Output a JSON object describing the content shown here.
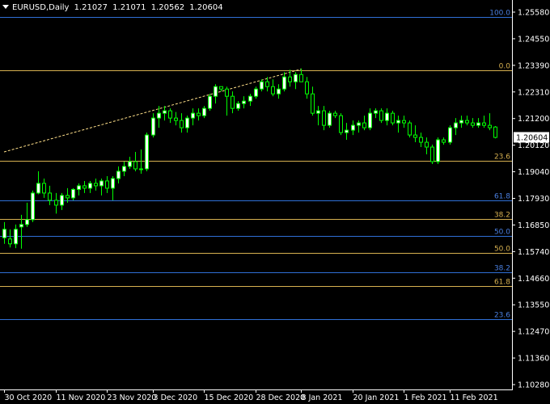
{
  "header": {
    "symbol": "EURUSD,Daily",
    "open": "1.21027",
    "high": "1.21071",
    "low": "1.20562",
    "close": "1.20604"
  },
  "price_axis": {
    "labels": [
      "1.25580",
      "1.24550",
      "1.23390",
      "1.22310",
      "1.21200",
      "1.20120",
      "1.19040",
      "1.17930",
      "1.16850",
      "1.15740",
      "1.14660",
      "1.13550",
      "1.12470",
      "1.11360",
      "1.10280"
    ],
    "current_price": "1.20604"
  },
  "time_axis": {
    "labels": [
      "30 Oct 2020",
      "11 Nov 2020",
      "23 Nov 2020",
      "3 Dec 2020",
      "15 Dec 2020",
      "28 Dec 2020",
      "8 Jan 2021",
      "20 Jan 2021",
      "1 Feb 2021",
      "11 Feb 2021"
    ]
  },
  "fibo_levels": [
    {
      "label": "100.0",
      "price": 1.2558,
      "color": "#2f6fd6",
      "label_color": "#4a7fe0"
    },
    {
      "label": "0.0",
      "price": 1.2339,
      "color": "#d6b050",
      "label_color": "#d6b050"
    },
    {
      "label": "23.6",
      "price": 1.1962,
      "color": "#d6b050",
      "label_color": "#d6b050"
    },
    {
      "label": "61.8",
      "price": 1.18,
      "color": "#2f6fd6",
      "label_color": "#4a7fe0"
    },
    {
      "label": "38.2",
      "price": 1.1722,
      "color": "#d6b050",
      "label_color": "#d6b050"
    },
    {
      "label": "50.0",
      "price": 1.1651,
      "color": "#2f6fd6",
      "label_color": "#4a7fe0"
    },
    {
      "label": "50.0",
      "price": 1.1581,
      "color": "#d6b050",
      "label_color": "#d6b050"
    },
    {
      "label": "38.2",
      "price": 1.1502,
      "color": "#2f6fd6",
      "label_color": "#4a7fe0"
    },
    {
      "label": "61.8",
      "price": 1.1445,
      "color": "#d6b050",
      "label_color": "#d6b050"
    },
    {
      "label": "23.6",
      "price": 1.1308,
      "color": "#2f6fd6",
      "label_color": "#4a7fe0"
    }
  ],
  "colors": {
    "background": "#000000",
    "bull": "#ffffff",
    "bear": "#000000",
    "wick": "#00ff00",
    "axis": "#ffffff",
    "trendline": "#ffe08a"
  },
  "chart_data": {
    "type": "candlestick",
    "symbol": "EURUSD",
    "timeframe": "Daily",
    "ylim": [
      1.1028,
      1.2588
    ],
    "trendline": {
      "from": {
        "date": "30 Oct 2020",
        "price": 1.2
      },
      "to": {
        "date": "31 Dec 2020",
        "price": 1.2342
      }
    },
    "candles": [
      {
        "o": 1.1645,
        "h": 1.171,
        "l": 1.162,
        "c": 1.168
      },
      {
        "o": 1.164,
        "h": 1.168,
        "l": 1.1605,
        "c": 1.162
      },
      {
        "o": 1.162,
        "h": 1.17,
        "l": 1.1602,
        "c": 1.168
      },
      {
        "o": 1.169,
        "h": 1.174,
        "l": 1.16,
        "c": 1.17
      },
      {
        "o": 1.17,
        "h": 1.179,
        "l": 1.169,
        "c": 1.172
      },
      {
        "o": 1.172,
        "h": 1.184,
        "l": 1.171,
        "c": 1.183
      },
      {
        "o": 1.183,
        "h": 1.192,
        "l": 1.1825,
        "c": 1.187
      },
      {
        "o": 1.187,
        "h": 1.189,
        "l": 1.181,
        "c": 1.183
      },
      {
        "o": 1.183,
        "h": 1.186,
        "l": 1.178,
        "c": 1.18
      },
      {
        "o": 1.18,
        "h": 1.183,
        "l": 1.1745,
        "c": 1.178
      },
      {
        "o": 1.178,
        "h": 1.183,
        "l": 1.176,
        "c": 1.182
      },
      {
        "o": 1.182,
        "h": 1.185,
        "l": 1.179,
        "c": 1.181
      },
      {
        "o": 1.181,
        "h": 1.185,
        "l": 1.18,
        "c": 1.1845
      },
      {
        "o": 1.1845,
        "h": 1.187,
        "l": 1.182,
        "c": 1.186
      },
      {
        "o": 1.186,
        "h": 1.188,
        "l": 1.183,
        "c": 1.185
      },
      {
        "o": 1.185,
        "h": 1.188,
        "l": 1.183,
        "c": 1.187
      },
      {
        "o": 1.187,
        "h": 1.189,
        "l": 1.184,
        "c": 1.186
      },
      {
        "o": 1.186,
        "h": 1.189,
        "l": 1.182,
        "c": 1.188
      },
      {
        "o": 1.188,
        "h": 1.19,
        "l": 1.183,
        "c": 1.185
      },
      {
        "o": 1.185,
        "h": 1.19,
        "l": 1.18,
        "c": 1.189
      },
      {
        "o": 1.189,
        "h": 1.194,
        "l": 1.187,
        "c": 1.192
      },
      {
        "o": 1.192,
        "h": 1.196,
        "l": 1.19,
        "c": 1.194
      },
      {
        "o": 1.194,
        "h": 1.198,
        "l": 1.193,
        "c": 1.196
      },
      {
        "o": 1.196,
        "h": 1.2,
        "l": 1.192,
        "c": 1.193
      },
      {
        "o": 1.193,
        "h": 1.201,
        "l": 1.191,
        "c": 1.193
      },
      {
        "o": 1.193,
        "h": 1.208,
        "l": 1.192,
        "c": 1.207
      },
      {
        "o": 1.207,
        "h": 1.216,
        "l": 1.206,
        "c": 1.214
      },
      {
        "o": 1.214,
        "h": 1.219,
        "l": 1.21,
        "c": 1.216
      },
      {
        "o": 1.216,
        "h": 1.219,
        "l": 1.213,
        "c": 1.217
      },
      {
        "o": 1.217,
        "h": 1.218,
        "l": 1.212,
        "c": 1.214
      },
      {
        "o": 1.214,
        "h": 1.2165,
        "l": 1.211,
        "c": 1.213
      },
      {
        "o": 1.213,
        "h": 1.216,
        "l": 1.208,
        "c": 1.21
      },
      {
        "o": 1.21,
        "h": 1.215,
        "l": 1.208,
        "c": 1.214
      },
      {
        "o": 1.214,
        "h": 1.218,
        "l": 1.211,
        "c": 1.216
      },
      {
        "o": 1.216,
        "h": 1.218,
        "l": 1.213,
        "c": 1.215
      },
      {
        "o": 1.215,
        "h": 1.219,
        "l": 1.214,
        "c": 1.218
      },
      {
        "o": 1.218,
        "h": 1.224,
        "l": 1.217,
        "c": 1.223
      },
      {
        "o": 1.223,
        "h": 1.228,
        "l": 1.22,
        "c": 1.227
      },
      {
        "o": 1.227,
        "h": 1.227,
        "l": 1.225,
        "c": 1.226
      },
      {
        "o": 1.226,
        "h": 1.227,
        "l": 1.215,
        "c": 1.223
      },
      {
        "o": 1.223,
        "h": 1.225,
        "l": 1.216,
        "c": 1.218
      },
      {
        "o": 1.218,
        "h": 1.221,
        "l": 1.217,
        "c": 1.22
      },
      {
        "o": 1.22,
        "h": 1.223,
        "l": 1.218,
        "c": 1.221
      },
      {
        "o": 1.221,
        "h": 1.224,
        "l": 1.219,
        "c": 1.223
      },
      {
        "o": 1.223,
        "h": 1.227,
        "l": 1.222,
        "c": 1.226
      },
      {
        "o": 1.226,
        "h": 1.23,
        "l": 1.225,
        "c": 1.229
      },
      {
        "o": 1.229,
        "h": 1.231,
        "l": 1.225,
        "c": 1.227
      },
      {
        "o": 1.227,
        "h": 1.23,
        "l": 1.223,
        "c": 1.224
      },
      {
        "o": 1.224,
        "h": 1.228,
        "l": 1.222,
        "c": 1.226
      },
      {
        "o": 1.226,
        "h": 1.233,
        "l": 1.225,
        "c": 1.231
      },
      {
        "o": 1.231,
        "h": 1.234,
        "l": 1.227,
        "c": 1.229
      },
      {
        "o": 1.229,
        "h": 1.233,
        "l": 1.226,
        "c": 1.232
      },
      {
        "o": 1.232,
        "h": 1.2345,
        "l": 1.229,
        "c": 1.229
      },
      {
        "o": 1.229,
        "h": 1.231,
        "l": 1.222,
        "c": 1.224
      },
      {
        "o": 1.224,
        "h": 1.227,
        "l": 1.215,
        "c": 1.216
      },
      {
        "o": 1.216,
        "h": 1.219,
        "l": 1.211,
        "c": 1.217
      },
      {
        "o": 1.217,
        "h": 1.219,
        "l": 1.209,
        "c": 1.211
      },
      {
        "o": 1.211,
        "h": 1.217,
        "l": 1.21,
        "c": 1.216
      },
      {
        "o": 1.216,
        "h": 1.217,
        "l": 1.214,
        "c": 1.215
      },
      {
        "o": 1.215,
        "h": 1.216,
        "l": 1.207,
        "c": 1.208
      },
      {
        "o": 1.208,
        "h": 1.212,
        "l": 1.205,
        "c": 1.209
      },
      {
        "o": 1.209,
        "h": 1.213,
        "l": 1.207,
        "c": 1.211
      },
      {
        "o": 1.211,
        "h": 1.213,
        "l": 1.208,
        "c": 1.212
      },
      {
        "o": 1.212,
        "h": 1.215,
        "l": 1.209,
        "c": 1.21
      },
      {
        "o": 1.21,
        "h": 1.218,
        "l": 1.209,
        "c": 1.216
      },
      {
        "o": 1.216,
        "h": 1.218,
        "l": 1.214,
        "c": 1.217
      },
      {
        "o": 1.217,
        "h": 1.218,
        "l": 1.212,
        "c": 1.213
      },
      {
        "o": 1.213,
        "h": 1.218,
        "l": 1.211,
        "c": 1.216
      },
      {
        "o": 1.216,
        "h": 1.217,
        "l": 1.211,
        "c": 1.212
      },
      {
        "o": 1.212,
        "h": 1.215,
        "l": 1.208,
        "c": 1.213
      },
      {
        "o": 1.213,
        "h": 1.215,
        "l": 1.21,
        "c": 1.212
      },
      {
        "o": 1.212,
        "h": 1.213,
        "l": 1.206,
        "c": 1.207
      },
      {
        "o": 1.207,
        "h": 1.211,
        "l": 1.204,
        "c": 1.206
      },
      {
        "o": 1.206,
        "h": 1.208,
        "l": 1.202,
        "c": 1.204
      },
      {
        "o": 1.204,
        "h": 1.206,
        "l": 1.199,
        "c": 1.202
      },
      {
        "o": 1.202,
        "h": 1.203,
        "l": 1.195,
        "c": 1.196
      },
      {
        "o": 1.196,
        "h": 1.206,
        "l": 1.195,
        "c": 1.205
      },
      {
        "o": 1.205,
        "h": 1.206,
        "l": 1.203,
        "c": 1.204
      },
      {
        "o": 1.204,
        "h": 1.211,
        "l": 1.203,
        "c": 1.21
      },
      {
        "o": 1.21,
        "h": 1.214,
        "l": 1.207,
        "c": 1.212
      },
      {
        "o": 1.212,
        "h": 1.215,
        "l": 1.21,
        "c": 1.213
      },
      {
        "o": 1.213,
        "h": 1.215,
        "l": 1.211,
        "c": 1.212
      },
      {
        "o": 1.212,
        "h": 1.214,
        "l": 1.21,
        "c": 1.211
      },
      {
        "o": 1.211,
        "h": 1.214,
        "l": 1.21,
        "c": 1.212
      },
      {
        "o": 1.212,
        "h": 1.215,
        "l": 1.21,
        "c": 1.211
      },
      {
        "o": 1.211,
        "h": 1.216,
        "l": 1.209,
        "c": 1.21
      },
      {
        "o": 1.2103,
        "h": 1.2107,
        "l": 1.2056,
        "c": 1.206
      }
    ]
  }
}
